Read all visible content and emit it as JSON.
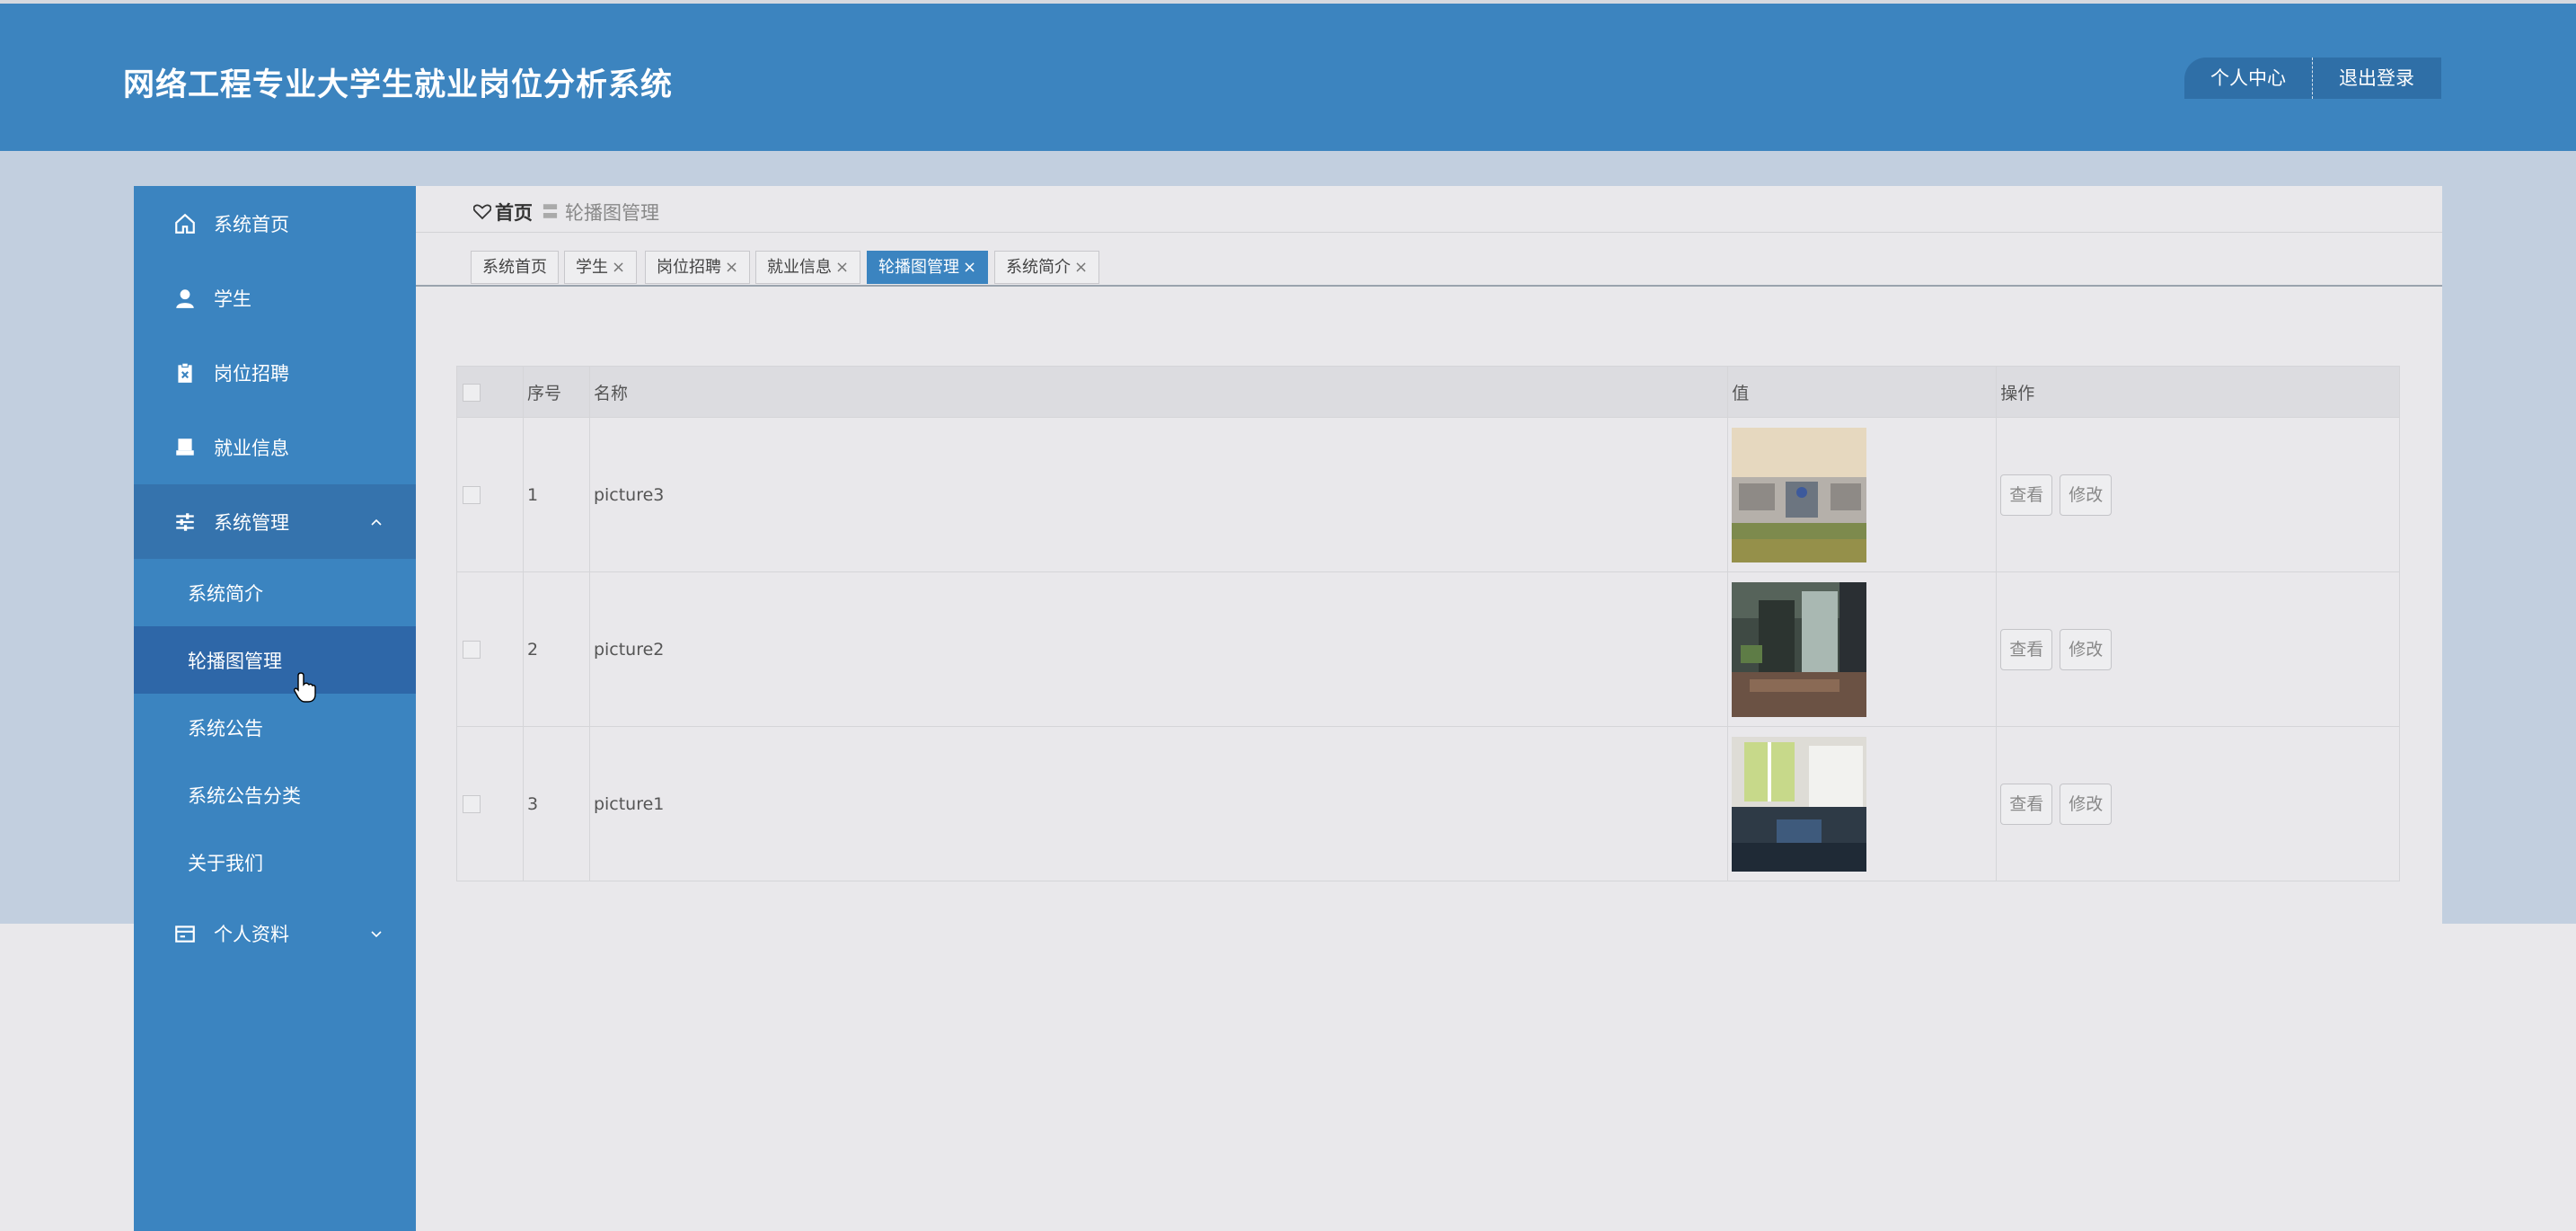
{
  "header": {
    "title": "网络工程专业大学生就业岗位分析系统",
    "user_center": "个人中心",
    "logout": "退出登录"
  },
  "sidebar": {
    "items": [
      {
        "label": "系统首页",
        "icon": "home-icon"
      },
      {
        "label": "学生",
        "icon": "user-icon"
      },
      {
        "label": "岗位招聘",
        "icon": "clipboard-icon"
      },
      {
        "label": "就业信息",
        "icon": "printer-icon"
      },
      {
        "label": "系统管理",
        "icon": "sliders-icon",
        "expanded": true
      },
      {
        "label": "个人资料",
        "icon": "card-icon",
        "expanded": false
      }
    ],
    "submenu": [
      "系统简介",
      "轮播图管理",
      "系统公告",
      "系统公告分类",
      "关于我们"
    ]
  },
  "breadcrumb": {
    "home": "首页",
    "separator": "〓",
    "current": "轮播图管理"
  },
  "tabs": [
    {
      "label": "系统首页",
      "closable": false
    },
    {
      "label": "学生",
      "closable": true
    },
    {
      "label": "岗位招聘",
      "closable": true
    },
    {
      "label": "就业信息",
      "closable": true
    },
    {
      "label": "轮播图管理",
      "closable": true,
      "active": true
    },
    {
      "label": "系统简介",
      "closable": true
    }
  ],
  "table": {
    "headers": {
      "index": "序号",
      "name": "名称",
      "value": "值",
      "actions": "操作"
    },
    "rows": [
      {
        "index": "1",
        "name": "picture3"
      },
      {
        "index": "2",
        "name": "picture2"
      },
      {
        "index": "3",
        "name": "picture1"
      }
    ],
    "view_label": "查看",
    "edit_label": "修改"
  },
  "colors": {
    "primary": "#3b84c0",
    "header": "#3c84bf",
    "active_submenu": "#2e67a8"
  }
}
